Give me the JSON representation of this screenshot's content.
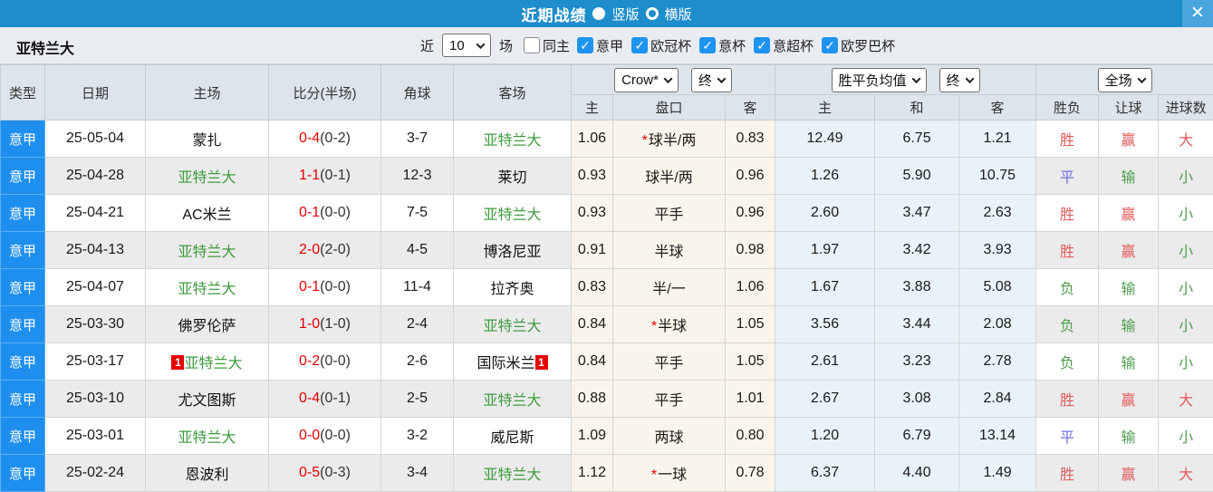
{
  "titlebar": {
    "title": "近期战绩",
    "radio_vertical": "竖版",
    "radio_horizontal": "横版",
    "selected_layout": "竖版",
    "close": "✕"
  },
  "filterbar": {
    "team": "亚特兰大",
    "near_label": "近",
    "near_value": "10",
    "games_label": "场",
    "same_venue_label": "同主",
    "same_venue_checked": false,
    "leagues": [
      {
        "label": "意甲",
        "checked": true
      },
      {
        "label": "欧冠杯",
        "checked": true
      },
      {
        "label": "意杯",
        "checked": true
      },
      {
        "label": "意超杯",
        "checked": true
      },
      {
        "label": "欧罗巴杯",
        "checked": true
      }
    ]
  },
  "table": {
    "dropdowns": {
      "odds_company": "Crow*",
      "odds_time": "终",
      "avg_label": "胜平负均值",
      "avg_time": "终",
      "scope": "全场"
    },
    "headers": {
      "type": "类型",
      "date": "日期",
      "home": "主场",
      "score": "比分(半场)",
      "corner": "角球",
      "away": "客场",
      "odds_home": "主",
      "handicap": "盘口",
      "odds_away": "客",
      "avg_home": "主",
      "avg_draw": "和",
      "avg_away": "客",
      "result": "胜负",
      "handicap_result": "让球",
      "goals": "进球数"
    },
    "rows": [
      {
        "type": "意甲",
        "date": "25-05-04",
        "home": "蒙扎",
        "home_is_target": false,
        "home_badge": "",
        "score": "0-4",
        "half": "(0-2)",
        "corner": "3-7",
        "away": "亚特兰大",
        "away_is_target": true,
        "away_badge": "",
        "odds_home": "1.06",
        "handicap_star": true,
        "handicap": "球半/两",
        "odds_away": "0.83",
        "avg_home": "12.49",
        "avg_draw": "6.75",
        "avg_away": "1.21",
        "result": "胜",
        "handicap_result": "赢",
        "goals": "大"
      },
      {
        "type": "意甲",
        "date": "25-04-28",
        "home": "亚特兰大",
        "home_is_target": true,
        "home_badge": "",
        "score": "1-1",
        "half": "(0-1)",
        "corner": "12-3",
        "away": "莱切",
        "away_is_target": false,
        "away_badge": "",
        "odds_home": "0.93",
        "handicap_star": false,
        "handicap": "球半/两",
        "odds_away": "0.96",
        "avg_home": "1.26",
        "avg_draw": "5.90",
        "avg_away": "10.75",
        "result": "平",
        "handicap_result": "输",
        "goals": "小"
      },
      {
        "type": "意甲",
        "date": "25-04-21",
        "home": "AC米兰",
        "home_is_target": false,
        "home_badge": "",
        "score": "0-1",
        "half": "(0-0)",
        "corner": "7-5",
        "away": "亚特兰大",
        "away_is_target": true,
        "away_badge": "",
        "odds_home": "0.93",
        "handicap_star": false,
        "handicap": "平手",
        "odds_away": "0.96",
        "avg_home": "2.60",
        "avg_draw": "3.47",
        "avg_away": "2.63",
        "result": "胜",
        "handicap_result": "赢",
        "goals": "小"
      },
      {
        "type": "意甲",
        "date": "25-04-13",
        "home": "亚特兰大",
        "home_is_target": true,
        "home_badge": "",
        "score": "2-0",
        "half": "(2-0)",
        "corner": "4-5",
        "away": "博洛尼亚",
        "away_is_target": false,
        "away_badge": "",
        "odds_home": "0.91",
        "handicap_star": false,
        "handicap": "半球",
        "odds_away": "0.98",
        "avg_home": "1.97",
        "avg_draw": "3.42",
        "avg_away": "3.93",
        "result": "胜",
        "handicap_result": "赢",
        "goals": "小"
      },
      {
        "type": "意甲",
        "date": "25-04-07",
        "home": "亚特兰大",
        "home_is_target": true,
        "home_badge": "",
        "score": "0-1",
        "half": "(0-0)",
        "corner": "11-4",
        "away": "拉齐奥",
        "away_is_target": false,
        "away_badge": "",
        "odds_home": "0.83",
        "handicap_star": false,
        "handicap": "半/一",
        "odds_away": "1.06",
        "avg_home": "1.67",
        "avg_draw": "3.88",
        "avg_away": "5.08",
        "result": "负",
        "handicap_result": "输",
        "goals": "小"
      },
      {
        "type": "意甲",
        "date": "25-03-30",
        "home": "佛罗伦萨",
        "home_is_target": false,
        "home_badge": "",
        "score": "1-0",
        "half": "(1-0)",
        "corner": "2-4",
        "away": "亚特兰大",
        "away_is_target": true,
        "away_badge": "",
        "odds_home": "0.84",
        "handicap_star": true,
        "handicap": "半球",
        "odds_away": "1.05",
        "avg_home": "3.56",
        "avg_draw": "3.44",
        "avg_away": "2.08",
        "result": "负",
        "handicap_result": "输",
        "goals": "小"
      },
      {
        "type": "意甲",
        "date": "25-03-17",
        "home": "亚特兰大",
        "home_is_target": true,
        "home_badge": "1",
        "score": "0-2",
        "half": "(0-0)",
        "corner": "2-6",
        "away": "国际米兰",
        "away_is_target": false,
        "away_badge": "1",
        "odds_home": "0.84",
        "handicap_star": false,
        "handicap": "平手",
        "odds_away": "1.05",
        "avg_home": "2.61",
        "avg_draw": "3.23",
        "avg_away": "2.78",
        "result": "负",
        "handicap_result": "输",
        "goals": "小"
      },
      {
        "type": "意甲",
        "date": "25-03-10",
        "home": "尤文图斯",
        "home_is_target": false,
        "home_badge": "",
        "score": "0-4",
        "half": "(0-1)",
        "corner": "2-5",
        "away": "亚特兰大",
        "away_is_target": true,
        "away_badge": "",
        "odds_home": "0.88",
        "handicap_star": false,
        "handicap": "平手",
        "odds_away": "1.01",
        "avg_home": "2.67",
        "avg_draw": "3.08",
        "avg_away": "2.84",
        "result": "胜",
        "handicap_result": "赢",
        "goals": "大"
      },
      {
        "type": "意甲",
        "date": "25-03-01",
        "home": "亚特兰大",
        "home_is_target": true,
        "home_badge": "",
        "score": "0-0",
        "half": "(0-0)",
        "corner": "3-2",
        "away": "威尼斯",
        "away_is_target": false,
        "away_badge": "",
        "odds_home": "1.09",
        "handicap_star": false,
        "handicap": "两球",
        "odds_away": "0.80",
        "avg_home": "1.20",
        "avg_draw": "6.79",
        "avg_away": "13.14",
        "result": "平",
        "handicap_result": "输",
        "goals": "小"
      },
      {
        "type": "意甲",
        "date": "25-02-24",
        "home": "恩波利",
        "home_is_target": false,
        "home_badge": "",
        "score": "0-5",
        "half": "(0-3)",
        "corner": "3-4",
        "away": "亚特兰大",
        "away_is_target": true,
        "away_badge": "",
        "odds_home": "1.12",
        "handicap_star": true,
        "handicap": "一球",
        "odds_away": "0.78",
        "avg_home": "6.37",
        "avg_draw": "4.40",
        "avg_away": "1.49",
        "result": "胜",
        "handicap_result": "赢",
        "goals": "大"
      }
    ]
  },
  "colors": {
    "titlebar_blue": "#1e8dcc",
    "close_button_blue": "#49a6dd",
    "type_column_blue": "#1e8fef",
    "checkbox_blue": "#1f94ee",
    "win_red": "#e05a5a",
    "draw_blue": "#6f6fe2",
    "lose_green": "#4f9d51",
    "score_red": "#e60000",
    "target_team_green": "#3f9b3f",
    "handicap_col_bg": "#faf5ea",
    "avg_col_bg": "#e8f2f9",
    "alt_row_bg": "#ebebeb"
  }
}
